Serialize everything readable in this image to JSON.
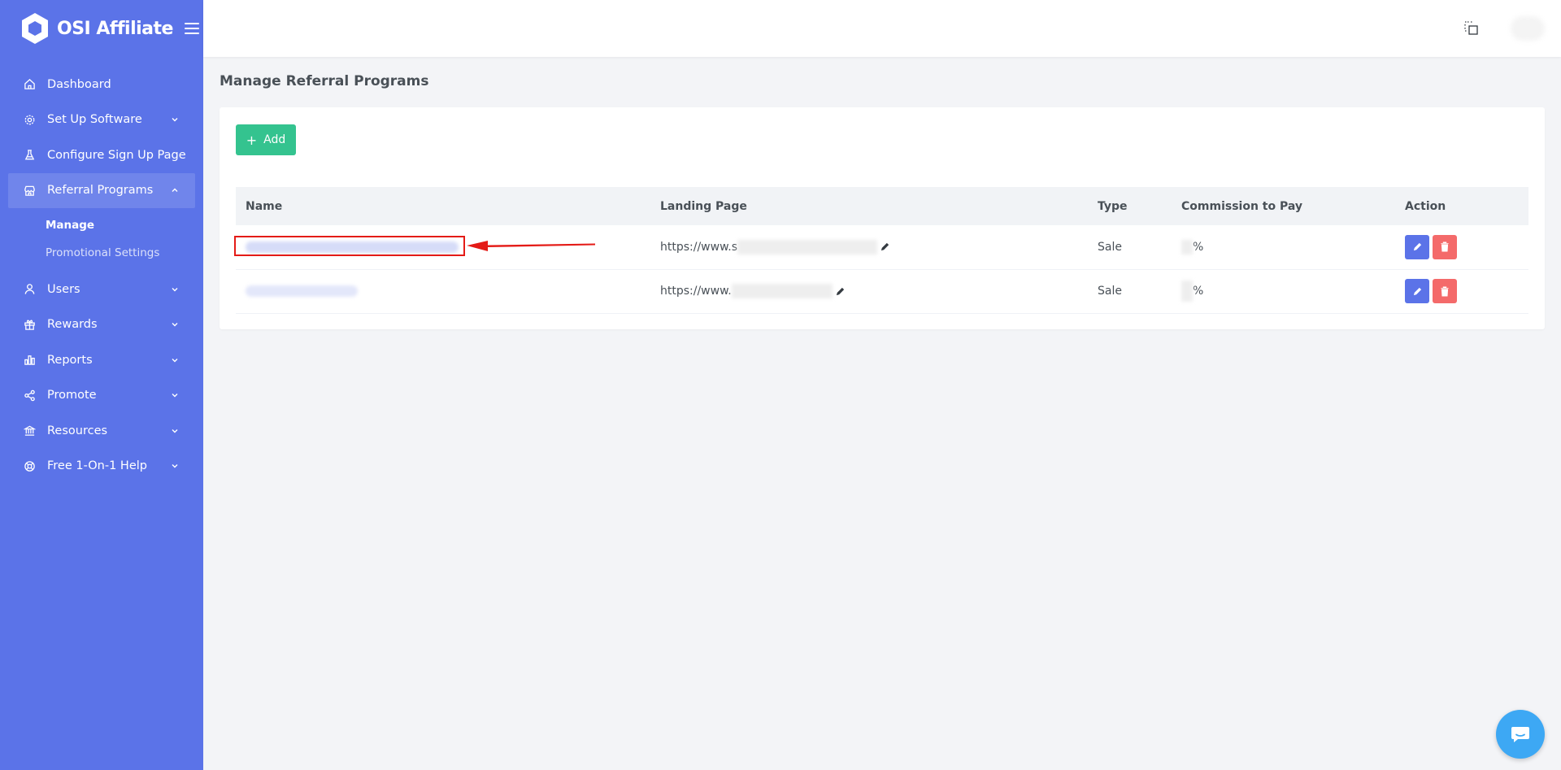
{
  "app": {
    "name": "OSI Affiliate"
  },
  "sidebar": {
    "items": [
      {
        "label": "Dashboard",
        "icon": "home-icon"
      },
      {
        "label": "Set Up Software",
        "icon": "gear-icon"
      },
      {
        "label": "Configure Sign Up Page",
        "icon": "flask-icon"
      },
      {
        "label": "Referral Programs",
        "icon": "store-icon"
      },
      {
        "label": "Users",
        "icon": "user-icon"
      },
      {
        "label": "Rewards",
        "icon": "gift-icon"
      },
      {
        "label": "Reports",
        "icon": "bar-chart-icon"
      },
      {
        "label": "Promote",
        "icon": "share-icon"
      },
      {
        "label": "Resources",
        "icon": "bank-icon"
      },
      {
        "label": "Free 1-On-1 Help",
        "icon": "lifebuoy-icon"
      }
    ],
    "submenu": [
      {
        "label": "Manage"
      },
      {
        "label": "Promotional Settings"
      }
    ]
  },
  "page": {
    "title": "Manage Referral Programs"
  },
  "toolbar": {
    "add_label": "Add"
  },
  "table": {
    "columns": [
      "Name",
      "Landing Page",
      "Type",
      "Commission to Pay",
      "Action"
    ],
    "rows": [
      {
        "landing_prefix": "https://www.s",
        "type": "Sale",
        "commission_suffix": "%"
      },
      {
        "landing_prefix": "https://www.",
        "type": "Sale",
        "commission_suffix": "%"
      }
    ]
  },
  "colors": {
    "sidebar": "#5b73e8",
    "add_button": "#34c38f",
    "edit_button": "#5b73e8",
    "delete_button": "#f46a6a",
    "annotation": "#e41b17",
    "chat": "#3da8f4"
  }
}
